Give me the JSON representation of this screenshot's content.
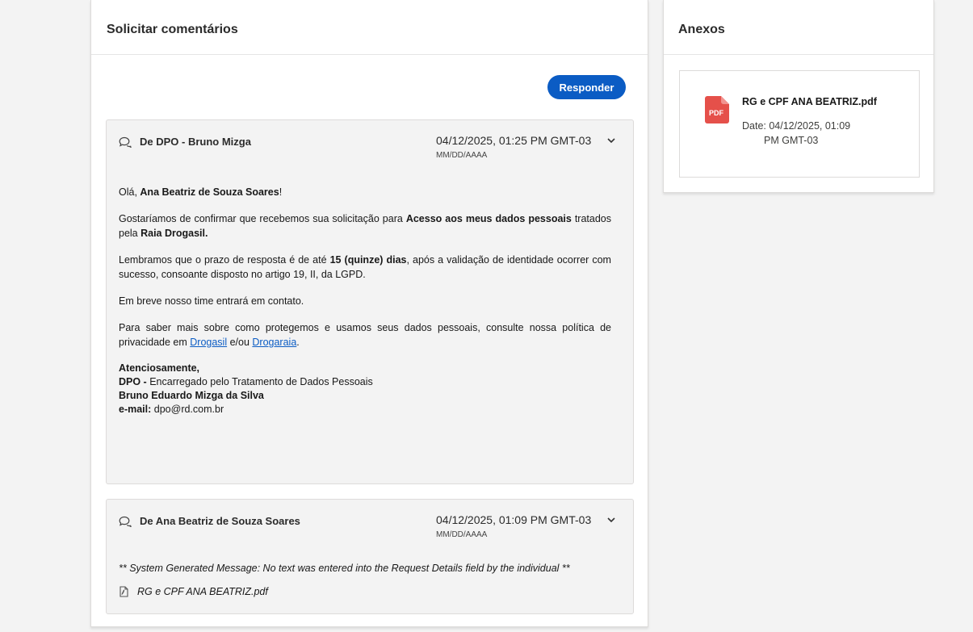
{
  "request_feedback": {
    "title": "Solicitar comentários",
    "reply_label": "Responder"
  },
  "messages": [
    {
      "from": "De DPO - Bruno Mizga",
      "datetime": "04/12/2025, 01:25 PM GMT-03",
      "date_format": "MM/DD/AAAA",
      "greeting_prefix": "Olá, ",
      "greeting_name": "Ana Beatriz de Souza Soares",
      "greeting_suffix": "!",
      "p1_a": "Gostaríamos de confirmar que recebemos sua solicitação para ",
      "p1_b": "Acesso aos meus dados pessoais",
      "p1_c": " tratados pela ",
      "p1_d": "Raia Drogasil.",
      "p2_a": "Lembramos que o prazo de resposta é de até ",
      "p2_b": "15 (quinze) dias",
      "p2_c": ", após a validação de identidade ocorrer com sucesso, consoante disposto no artigo 19, II, da LGPD.",
      "p3": "Em breve nosso time entrará em contato.",
      "p4_a": "Para saber mais sobre como protegemos e usamos seus dados pessoais, consulte nossa política de privacidade em ",
      "link1": "Drogasil",
      "p4_b": " e/ou ",
      "link2": "Drogaraia",
      "p4_c": ".",
      "sign_regards": "Atenciosamente,",
      "sign_dpo": "DPO - ",
      "sign_role": "Encarregado pelo Tratamento de Dados Pessoais",
      "sign_name": "Bruno Eduardo Mizga da Silva",
      "sign_email_label": "e-mail:",
      "sign_email": " dpo@rd.com.br"
    },
    {
      "from": "De Ana Beatriz de Souza Soares",
      "datetime": "04/12/2025, 01:09 PM GMT-03",
      "date_format": "MM/DD/AAAA",
      "system_message": "** System Generated Message: No text was entered into the Request Details field by the individual **",
      "attachment": "RG e CPF ANA BEATRIZ.pdf"
    }
  ],
  "attachments": {
    "title": "Anexos",
    "file": {
      "icon_label": "PDF",
      "name": "RG e CPF ANA BEATRIZ.pdf",
      "date_line1": "Date: 04/12/2025, 01:09",
      "date_line2": "PM GMT-03"
    }
  },
  "colors": {
    "accent": "#0b5cc4",
    "pdf_red": "#e5504a",
    "background": "#f3f3f3"
  }
}
